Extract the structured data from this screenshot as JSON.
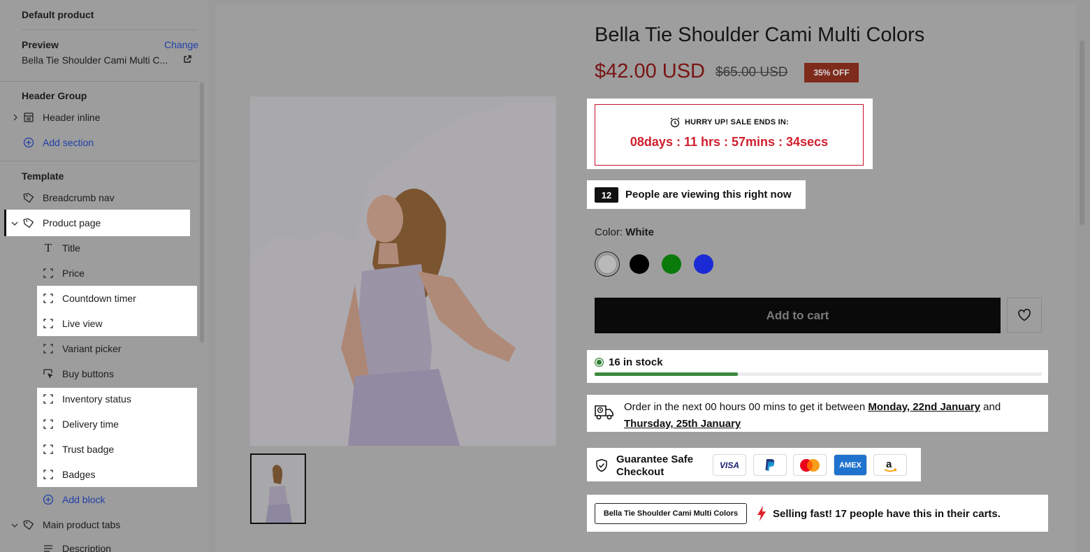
{
  "sidebar": {
    "title": "Default product",
    "preview_label": "Preview",
    "change_label": "Change",
    "preview_value": "Bella Tie Shoulder Cami Multi C...",
    "header_group_label": "Header Group",
    "header_inline_label": "Header inline",
    "add_section_label": "Add section",
    "template_label": "Template",
    "breadcrumb_label": "Breadcrumb nav",
    "product_page_label": "Product page",
    "blocks": {
      "title": "Title",
      "price": "Price",
      "countdown": "Countdown timer",
      "live_view": "Live view",
      "variant_picker": "Variant picker",
      "buy_buttons": "Buy buttons",
      "inventory": "Inventory status",
      "delivery": "Delivery time",
      "trust_badge": "Trust badge",
      "badges": "Badges"
    },
    "add_block_label": "Add block",
    "main_tabs_label": "Main product tabs",
    "description_label": "Description"
  },
  "product": {
    "title": "Bella Tie Shoulder Cami Multi Colors",
    "price": "$42.00 USD",
    "compare_price": "$65.00 USD",
    "discount_badge": "35% OFF",
    "countdown": {
      "heading": "HURRY UP! SALE ENDS IN:",
      "time": "08days :  11 hrs : 57mins : 34secs"
    },
    "live_view": {
      "count": "12",
      "text": "People are viewing this right now"
    },
    "color": {
      "label": "Color:",
      "value": "White",
      "swatches": [
        "#ffffff",
        "#000000",
        "#0a7a0a",
        "#1a2bd6"
      ]
    },
    "add_to_cart": "Add to cart",
    "stock": {
      "text": "16 in stock",
      "fill_fraction": 0.32
    },
    "delivery": {
      "prefix": "Order in the next 00 hours 00 mins to get it between",
      "date1": "Monday, 22nd January",
      "and": "and",
      "date2": "Thursday, 25th January"
    },
    "trust_badge": {
      "title": "Guarantee Safe Checkout",
      "cards": [
        "VISA",
        "PayPal",
        "Mastercard",
        "AMEX",
        "Amazon"
      ]
    },
    "selling_fast": {
      "product": "Bella Tie Shoulder Cami Multi Colors",
      "text": "Selling fast! 17 people have this in their carts."
    }
  },
  "colors": {
    "sale_red": "#c8102e",
    "stock_green": "#3c8a3f",
    "link_blue": "#1f3fa8"
  }
}
